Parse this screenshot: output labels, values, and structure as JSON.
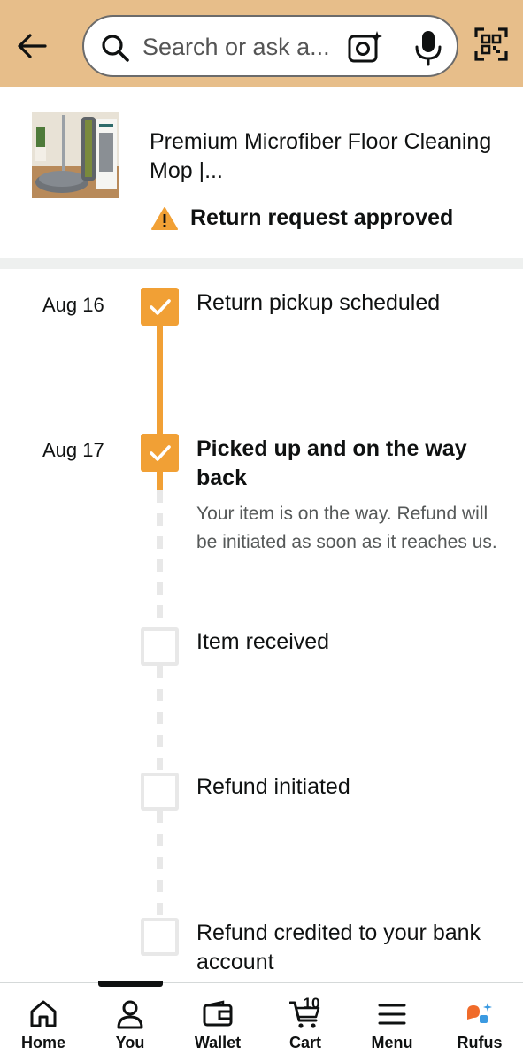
{
  "header": {
    "search_placeholder": "Search or ask a question",
    "search_display": "Search or ask a..."
  },
  "product": {
    "title": "Premium Microfiber Floor Cleaning Mop |...",
    "status": "Return request approved",
    "status_icon": "warning-icon"
  },
  "timeline": {
    "steps": [
      {
        "date": "Aug 16",
        "label": "Return pickup scheduled",
        "done": true
      },
      {
        "date": "Aug 17",
        "label": "Picked up and on the way back",
        "done": true,
        "description": "Your item is on the way. Refund will be initiated as soon as it reaches us."
      },
      {
        "date": "",
        "label": "Item received",
        "done": false
      },
      {
        "date": "",
        "label": "Refund initiated",
        "done": false
      },
      {
        "date": "",
        "label": "Refund credited to your bank account",
        "done": false
      }
    ]
  },
  "bottom_nav": {
    "items": [
      {
        "label": "Home",
        "icon": "home-icon"
      },
      {
        "label": "You",
        "icon": "person-icon"
      },
      {
        "label": "Wallet",
        "icon": "wallet-icon"
      },
      {
        "label": "Cart",
        "icon": "cart-icon"
      },
      {
        "label": "Menu",
        "icon": "menu-icon"
      },
      {
        "label": "Rufus",
        "icon": "rufus-icon"
      }
    ],
    "cart_count": "10"
  },
  "colors": {
    "header_bg": "#e7be8a",
    "accent_orange": "#f1a035",
    "pending_gray": "#e8e8e8"
  }
}
